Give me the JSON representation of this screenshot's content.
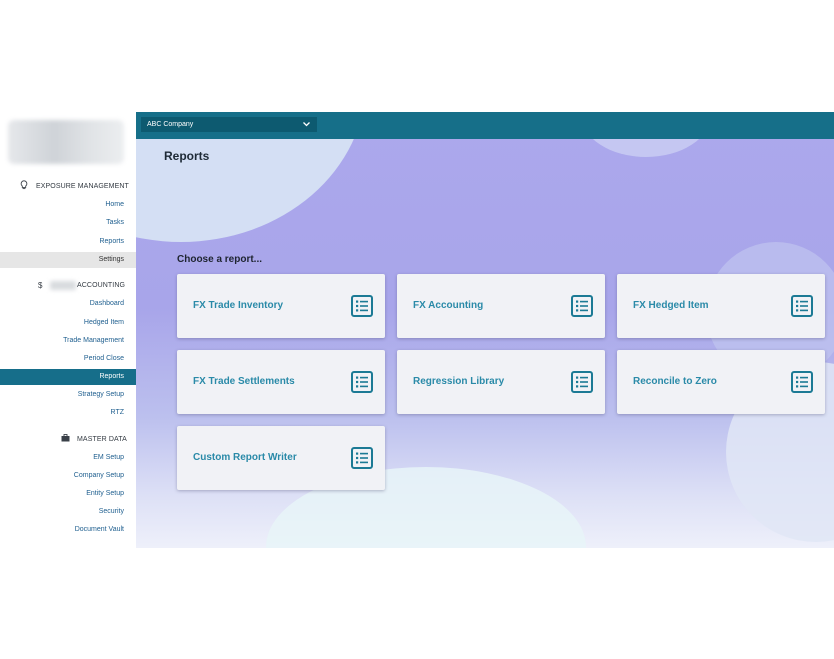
{
  "sidebar": {
    "sections": [
      {
        "title": "EXPOSURE MANAGEMENT",
        "icon": "lightbulb-icon",
        "items": [
          "Home",
          "Tasks",
          "Reports",
          "Settings"
        ]
      },
      {
        "title": "ACCOUNTING",
        "icon": "dollar-icon",
        "icon_glyph": "$",
        "items": [
          "Dashboard",
          "Hedged Item",
          "Trade Management",
          "Period Close",
          "Reports",
          "Strategy Setup",
          "RTZ"
        ]
      },
      {
        "title": "MASTER DATA",
        "icon": "briefcase-icon",
        "items": [
          "EM Setup",
          "Company Setup",
          "Entity Setup",
          "Security",
          "Document Vault"
        ]
      }
    ],
    "highlighted_item": "Settings",
    "active_item": "Reports"
  },
  "topbar": {
    "company": "ABC Company",
    "chevron": "chevron-down-icon"
  },
  "main": {
    "title": "Reports",
    "prompt": "Choose a report...",
    "reports": [
      "FX Trade Inventory",
      "FX Accounting",
      "FX Hedged Item",
      "FX Trade Settlements",
      "Regression Library",
      "Reconcile to Zero",
      "Custom Report Writer"
    ]
  },
  "colors": {
    "teal": "#166f89",
    "card_text": "#2a8aa8",
    "background": "#aca8ec"
  }
}
